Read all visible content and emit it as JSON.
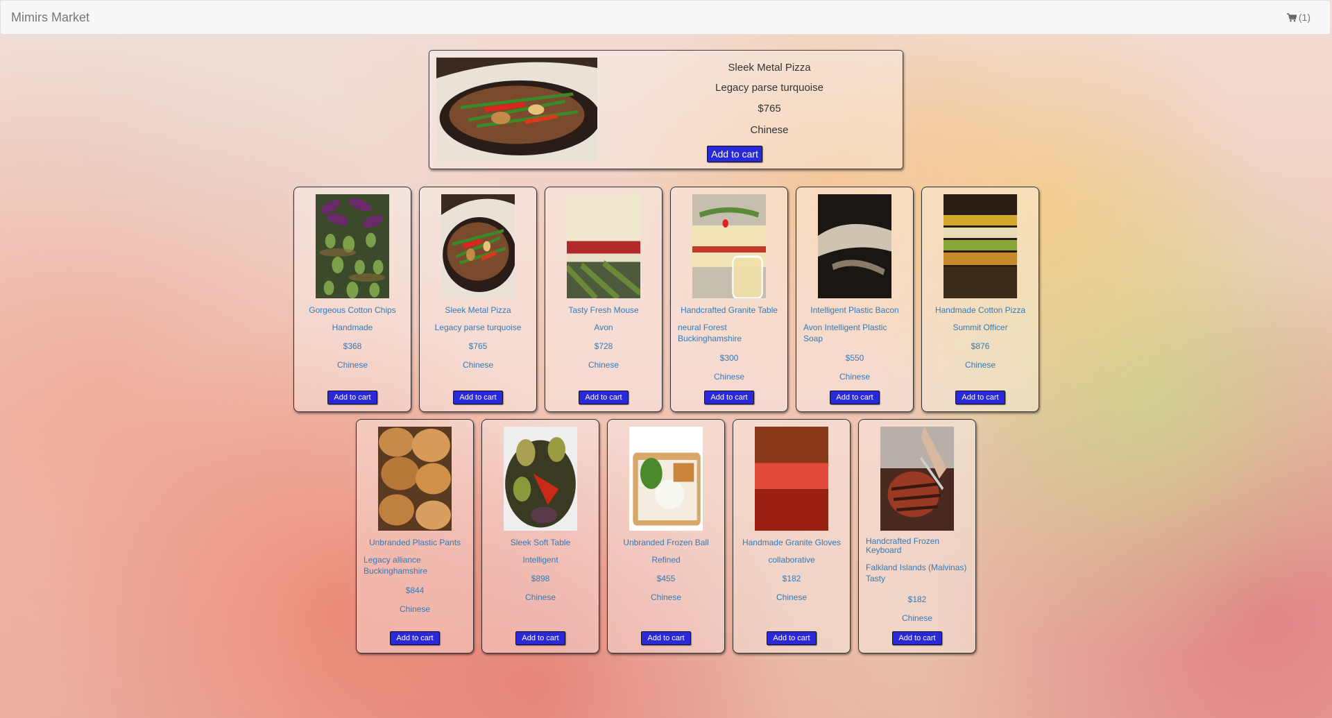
{
  "navbar": {
    "brand": "Mimirs Market",
    "cart_icon": "shopping-cart-icon",
    "cart_count": "(1)"
  },
  "featured": {
    "name": "Sleek Metal Pizza",
    "description": "Legacy parse turquoise",
    "price": "$765",
    "category": "Chinese",
    "button": "Add to cart",
    "image": "stir-fry-pan-photo"
  },
  "products": [
    {
      "name": "Gorgeous Cotton Chips",
      "description": "Handmade",
      "price": "$368",
      "category": "Chinese",
      "button": "Add to cart",
      "image": "eggplant-basket-photo"
    },
    {
      "name": "Sleek Metal Pizza",
      "description": "Legacy parse turquoise",
      "price": "$765",
      "category": "Chinese",
      "button": "Add to cart",
      "image": "stir-fry-pan-photo"
    },
    {
      "name": "Tasty Fresh Mouse",
      "description": "Avon",
      "price": "$728",
      "category": "Chinese",
      "button": "Add to cart",
      "image": "layered-dessert-photo"
    },
    {
      "name": "Handcrafted Granite Table",
      "description": "neural Forest Buckinghamshire",
      "price": "$300",
      "category": "Chinese",
      "button": "Add to cart",
      "image": "panna-cotta-glass-photo"
    },
    {
      "name": "Intelligent Plastic Bacon",
      "description": "Avon Intelligent Plastic Soap",
      "price": "$550",
      "category": "Chinese",
      "button": "Add to cart",
      "image": "dark-plate-photo"
    },
    {
      "name": "Handmade Cotton Pizza",
      "description": "Summit Officer",
      "price": "$876",
      "category": "Chinese",
      "button": "Add to cart",
      "image": "blurred-food-photo"
    },
    {
      "name": "Unbranded Plastic Pants",
      "description": "Legacy alliance Buckinghamshire",
      "price": "$844",
      "category": "Chinese",
      "button": "Add to cart",
      "image": "bread-loaves-photo"
    },
    {
      "name": "Sleek Soft Table",
      "description": "Intelligent",
      "price": "$898",
      "category": "Chinese",
      "button": "Add to cart",
      "image": "grilled-vegetables-photo"
    },
    {
      "name": "Unbranded Frozen Ball",
      "description": "Refined",
      "price": "$455",
      "category": "Chinese",
      "button": "Add to cart",
      "image": "bento-box-photo"
    },
    {
      "name": "Handmade Granite Gloves",
      "description": "collaborative",
      "price": "$182",
      "category": "Chinese",
      "button": "Add to cart",
      "image": "red-blur-photo"
    },
    {
      "name": "Handcrafted Frozen Keyboard",
      "description": "Falkland Islands (Malvinas) Tasty",
      "price": "$182",
      "category": "Chinese",
      "button": "Add to cart",
      "image": "grilled-steak-photo"
    }
  ],
  "colors": {
    "button": "#2929d9",
    "link_text": "#337ab7",
    "navbar_bg": "#f8f8f8"
  }
}
